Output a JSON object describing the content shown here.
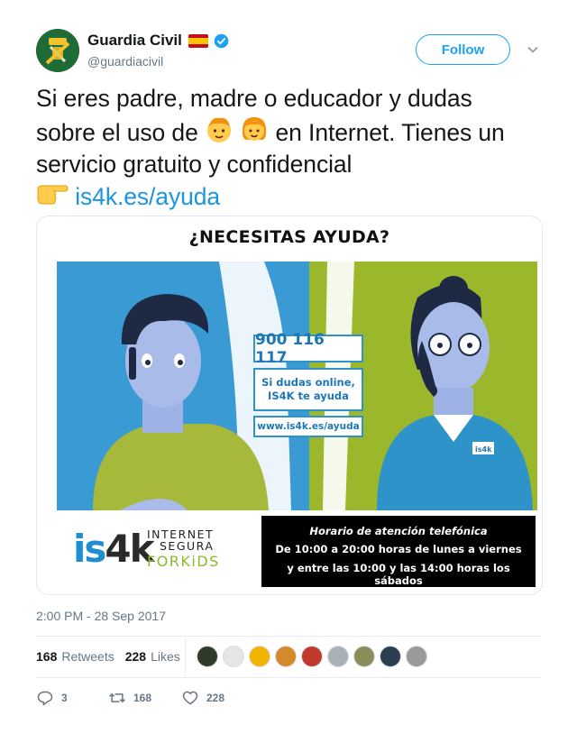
{
  "header": {
    "name": "Guardia Civil",
    "handle": "@guardiacivil",
    "follow_label": "Follow",
    "flag_icon": "spain-flag-icon",
    "verified_icon": "verified-badge-icon"
  },
  "tweet": {
    "line1": "Si eres padre, madre o educador y dudas",
    "line2a": "sobre el uso de",
    "line2b": "en Internet. Tienes un",
    "line3": "servicio gratuito y confidencial",
    "link": "is4k.es/ayuda",
    "emojis": [
      "boy-emoji",
      "girl-emoji",
      "pointing-right-emoji"
    ]
  },
  "poster": {
    "title": "¿NECESITAS AYUDA?",
    "phone": "900 116 117",
    "doubts_l1": "Si dudas online,",
    "doubts_l2": "IS4K te ayuda",
    "url": "www.is4k.es/ayuda",
    "badge": "is4k",
    "logo_is": "is",
    "logo_4k": "4k",
    "logo_line1": "INTERNET",
    "logo_line2": "SEGURA",
    "logo_line3": "FORKiDS",
    "schedule_title": "Horario de atención telefónica",
    "schedule_l1": "De 10:00 a 20:00 horas de lunes a viernes",
    "schedule_l2": "y entre las 10:00 y las 14:00 horas los sábados",
    "colors": {
      "blue": "#2d93c9",
      "green": "#9bb72c",
      "dark_blue": "#1d77b6"
    }
  },
  "meta": {
    "timestamp": "2:00 PM - 28 Sep 2017",
    "retweets_count": "168",
    "retweets_label": "Retweets",
    "likes_count": "228",
    "likes_label": "Likes",
    "liker_colors": [
      "#2f3a2a",
      "#e5e5e5",
      "#f2b400",
      "#d48a2a",
      "#c0392b",
      "#aab1b8",
      "#8c8c5a",
      "#2c3e50",
      "#9a9a9a"
    ]
  },
  "actions": {
    "reply_count": "3",
    "retweet_count": "168",
    "like_count": "228"
  }
}
